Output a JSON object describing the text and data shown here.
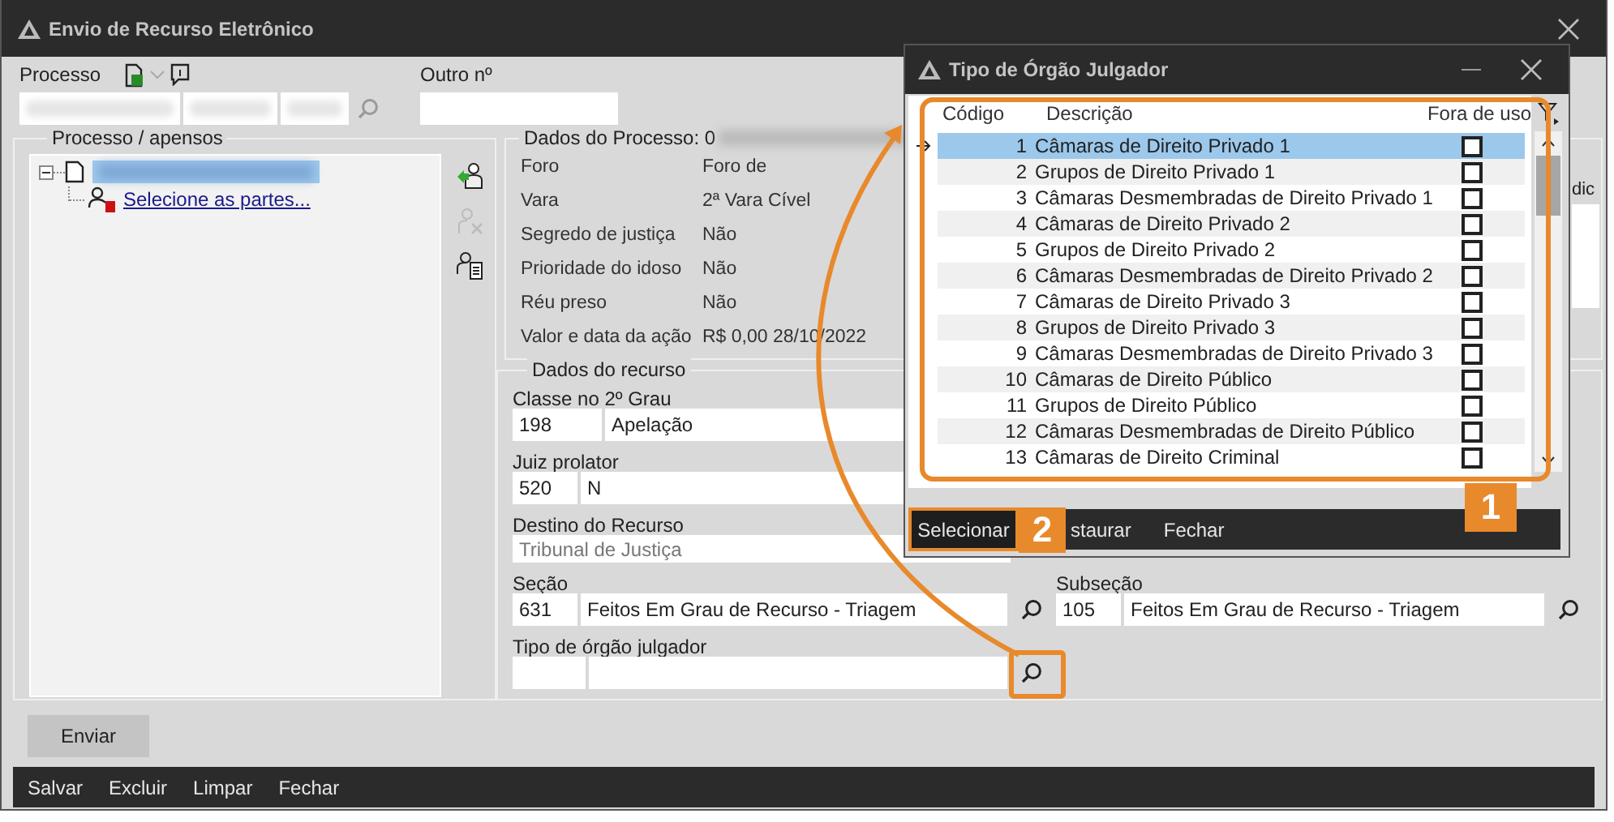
{
  "window": {
    "title": "Envio de Recurso Eletrônico"
  },
  "header": {
    "processo_label": "Processo",
    "outro_label": "Outro nº"
  },
  "tree_group": {
    "title": "Processo / apensos",
    "node": {
      "expanded": true,
      "selected": true,
      "children": [
        {
          "link": "Selecione as partes..."
        }
      ]
    }
  },
  "process_data": {
    "title": "Dados do Processo: 0",
    "side_label": "dic",
    "rows": [
      {
        "label": "Foro",
        "value": "Foro de"
      },
      {
        "label": "Vara",
        "value": "2ª Vara Cível"
      },
      {
        "label": "Segredo de justiça",
        "value": "Não"
      },
      {
        "label": "Prioridade do idoso",
        "value": "Não"
      },
      {
        "label": "Réu preso",
        "value": "Não"
      },
      {
        "label": "Valor e data da ação",
        "value": "R$ 0,00 28/10/2022"
      }
    ]
  },
  "recurso": {
    "title": "Dados do recurso",
    "classe": {
      "label": "Classe no 2º Grau",
      "code": "198",
      "description": "Apelação"
    },
    "juiz": {
      "label": "Juiz prolator",
      "code": "520",
      "description": "N"
    },
    "destino": {
      "label": "Destino do Recurso",
      "value": "Tribunal de Justiça",
      "disabled": true
    },
    "secao": {
      "label": "Seção",
      "code": "631",
      "description": "Feitos Em Grau de Recurso - Triagem"
    },
    "subsecao": {
      "label": "Subseção",
      "code": "105",
      "description": "Feitos Em Grau de Recurso - Triagem"
    },
    "tipo": {
      "label": "Tipo de órgão julgador",
      "highlighted": true
    }
  },
  "send_button": {
    "label": "Enviar"
  },
  "toolbar": [
    {
      "label": "Salvar"
    },
    {
      "label": "Excluir"
    },
    {
      "label": "Limpar"
    },
    {
      "label": "Fechar"
    }
  ],
  "dialog": {
    "title": "Tipo de Órgão Julgador",
    "columns": [
      "Código",
      "Descrição",
      "Fora de uso"
    ],
    "rows": [
      {
        "code": "1",
        "description": "Câmaras de Direito Privado 1",
        "out_of_use": false,
        "selected": true
      },
      {
        "code": "2",
        "description": "Grupos de Direito Privado 1",
        "out_of_use": false,
        "selected": false
      },
      {
        "code": "3",
        "description": "Câmaras Desmembradas de Direito Privado 1",
        "out_of_use": false,
        "selected": false
      },
      {
        "code": "4",
        "description": "Câmaras de Direito Privado 2",
        "out_of_use": false,
        "selected": false
      },
      {
        "code": "5",
        "description": "Grupos de Direito Privado 2",
        "out_of_use": false,
        "selected": false
      },
      {
        "code": "6",
        "description": "Câmaras Desmembradas de Direito Privado 2",
        "out_of_use": false,
        "selected": false
      },
      {
        "code": "7",
        "description": "Câmaras de Direito Privado 3",
        "out_of_use": false,
        "selected": false
      },
      {
        "code": "8",
        "description": "Grupos de Direito Privado 3",
        "out_of_use": false,
        "selected": false
      },
      {
        "code": "9",
        "description": "Câmaras Desmembradas de Direito Privado 3",
        "out_of_use": false,
        "selected": false
      },
      {
        "code": "10",
        "description": "Câmaras de Direito Público",
        "out_of_use": false,
        "selected": false
      },
      {
        "code": "11",
        "description": "Grupos de Direito Público",
        "out_of_use": false,
        "selected": false
      },
      {
        "code": "12",
        "description": "Câmaras Desmembradas de Direito Público",
        "out_of_use": false,
        "selected": false
      },
      {
        "code": "13",
        "description": "Câmaras de Direito Criminal",
        "out_of_use": false,
        "selected": false
      }
    ],
    "buttons": [
      {
        "label": "Selecionar",
        "highlighted": true
      },
      {
        "label": "staurar"
      },
      {
        "label": "Fechar"
      }
    ]
  },
  "callouts": [
    {
      "number": "1"
    },
    {
      "number": "2"
    }
  ]
}
